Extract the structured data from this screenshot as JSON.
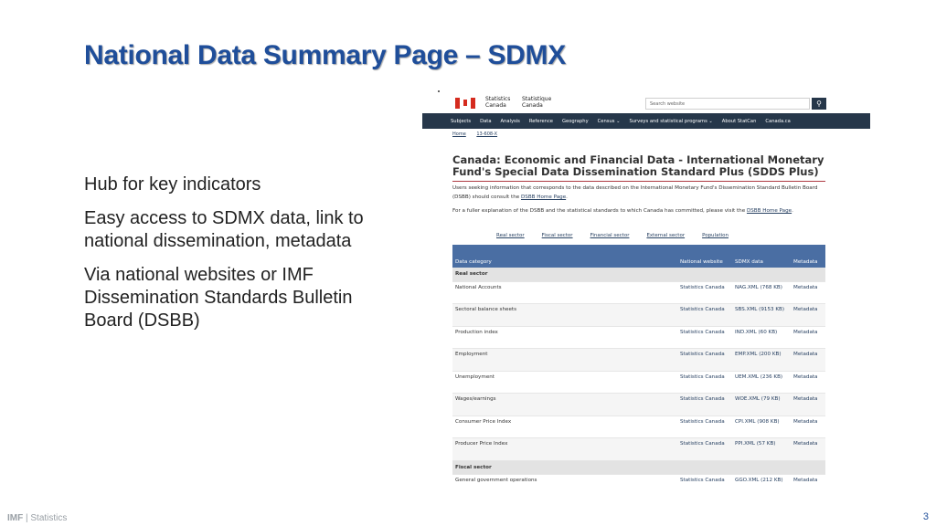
{
  "slide": {
    "title": "National Data Summary Page – SDMX",
    "bullets": [
      "Hub for key indicators",
      "Easy access to SDMX data, link to national dissemination, metadata",
      "Via national websites or IMF Dissemination Standards Bulletin Board (DSBB)"
    ],
    "footer_brand": "IMF",
    "footer_section": "| Statistics",
    "page_number": "3"
  },
  "screenshot": {
    "agency_en": "Statistics\nCanada",
    "agency_fr": "Statistique\nCanada",
    "search_placeholder": "Search website",
    "search_icon": "magnifier-icon",
    "nav": [
      "Subjects",
      "Data",
      "Analysis",
      "Reference",
      "Geography",
      "Census ⌄",
      "Surveys and statistical programs ⌄",
      "About StatCan",
      "Canada.ca"
    ],
    "breadcrumbs": [
      "Home",
      "13-608-X"
    ],
    "heading": "Canada: Economic and Financial Data - International Monetary Fund's Special Data Dissemination Standard Plus (SDDS Plus)",
    "para1_text": "Users seeking information that corresponds to the data described on the International Monetary Fund's Dissemination Standard Bulletin Board (DSBB) should consult the ",
    "para1_link": "DSBB Home Page",
    "para2_text": "For a fuller explanation of the DSBB and the statistical standards to which Canada has committed, please visit the ",
    "para2_link": "DSBB Home Page",
    "sector_links": [
      "Real sector",
      "Fiscal sector",
      "Financial sector",
      "External sector",
      "Population"
    ],
    "table": {
      "headers": [
        "Data category",
        "National website",
        "SDMX data",
        "Metadata"
      ],
      "rows": [
        {
          "group": true,
          "category": "Real sector"
        },
        {
          "category": "National Accounts",
          "website": "Statistics Canada",
          "sdmx": "NAG.XML (768 KB)",
          "metadata": "Metadata"
        },
        {
          "category": "Sectoral balance sheets",
          "website": "Statistics Canada",
          "sdmx": "SBS.XML (9153 KB)",
          "metadata": "Metadata"
        },
        {
          "category": "Production index",
          "website": "Statistics Canada",
          "sdmx": "IND.XML (60 KB)",
          "metadata": "Metadata"
        },
        {
          "category": "Employment",
          "website": "Statistics Canada",
          "sdmx": "EMP.XML (200 KB)",
          "metadata": "Metadata"
        },
        {
          "category": "Unemployment",
          "website": "Statistics Canada",
          "sdmx": "UEM.XML (236 KB)",
          "metadata": "Metadata"
        },
        {
          "category": "Wages/earnings",
          "website": "Statistics Canada",
          "sdmx": "WOE.XML (79 KB)",
          "metadata": "Metadata"
        },
        {
          "category": "Consumer Price Index",
          "website": "Statistics Canada",
          "sdmx": "CPI.XML (908 KB)",
          "metadata": "Metadata"
        },
        {
          "category": "Producer Price Index",
          "website": "Statistics Canada",
          "sdmx": "PPI.XML (57 KB)",
          "metadata": "Metadata"
        },
        {
          "group": true,
          "category": "Fiscal sector"
        },
        {
          "category": "General government operations",
          "website": "Statistics Canada",
          "sdmx": "GGO.XML (212 KB)",
          "metadata": "Metadata"
        }
      ]
    }
  }
}
